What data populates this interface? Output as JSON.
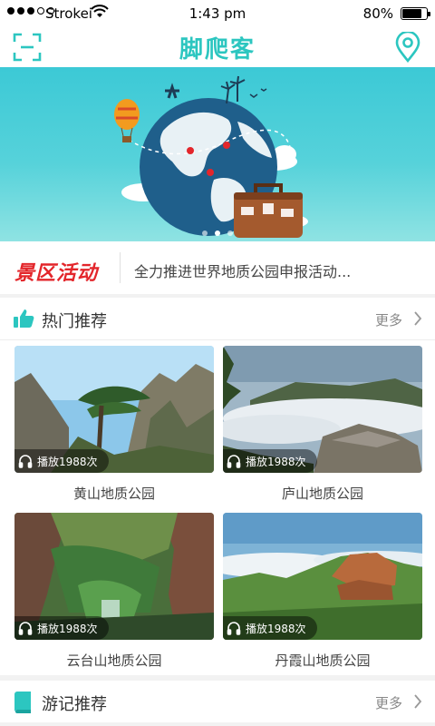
{
  "status_bar": {
    "carrier": "Strokei",
    "time": "1:43 pm",
    "battery": "80%",
    "battery_level": 0.8
  },
  "nav": {
    "title": "脚爬客",
    "left_icon": "scan-icon",
    "right_icon": "location-pin-icon"
  },
  "banner": {
    "slide_count": 3,
    "active_slide": 1
  },
  "news": {
    "tag": "景区活动",
    "headline": "全力推进世界地质公园申报活动..."
  },
  "hot_section": {
    "title": "热门推荐",
    "more": "更多",
    "icon": "thumbs-up-icon",
    "cards": [
      {
        "name": "黄山地质公园",
        "plays": "播放1988次"
      },
      {
        "name": "庐山地质公园",
        "plays": "播放1988次"
      },
      {
        "name": "云台山地质公园",
        "plays": "播放1988次"
      },
      {
        "name": "丹霞山地质公园",
        "plays": "播放1988次"
      }
    ]
  },
  "travel_section": {
    "title": "游记推荐",
    "more": "更多",
    "icon": "book-icon"
  },
  "colors": {
    "accent": "#2cc6c0",
    "news_tag": "#e3262b"
  }
}
